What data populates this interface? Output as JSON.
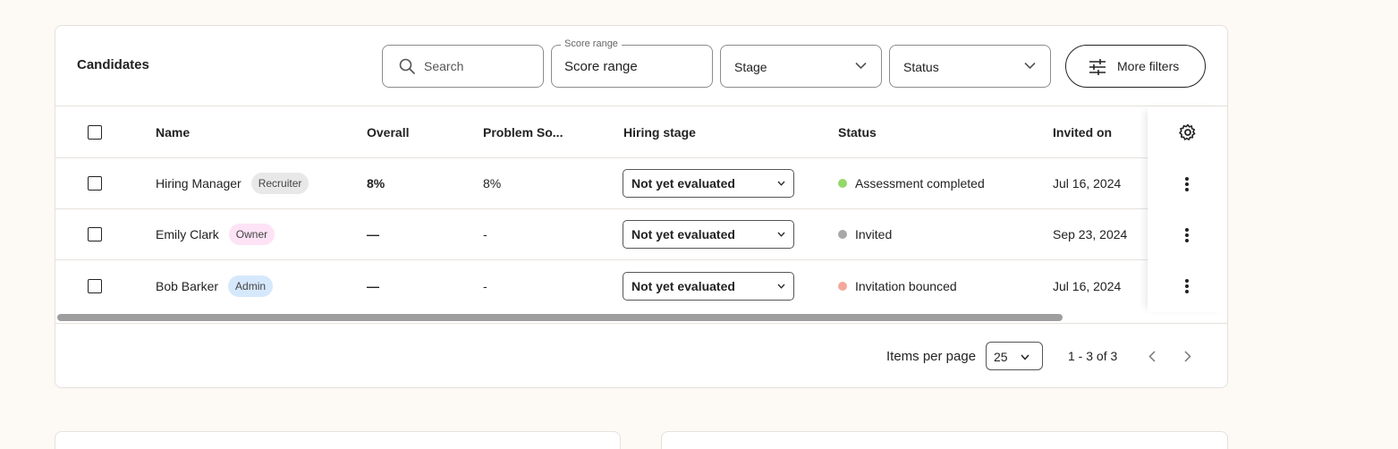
{
  "card": {
    "title": "Candidates",
    "filters": {
      "search_placeholder": "Search",
      "score_range_legend": "Score range",
      "score_range_value": "Score range",
      "stage_label": "Stage",
      "status_label": "Status",
      "more_filters_label": "More filters"
    }
  },
  "table": {
    "headers": {
      "name": "Name",
      "overall": "Overall",
      "problem_solving": "Problem So...",
      "hiring_stage": "Hiring stage",
      "status": "Status",
      "invited_on": "Invited on"
    },
    "rows": [
      {
        "name": "Hiring Manager",
        "role": "Recruiter",
        "role_color": "#e8e8e8",
        "overall": "8%",
        "problem_solving": "8%",
        "hiring_stage": "Not yet evaluated",
        "status": "Assessment completed",
        "status_color": "#94d86a",
        "invited_on": "Jul 16, 2024"
      },
      {
        "name": "Emily Clark",
        "role": "Owner",
        "role_color": "#fde3f5",
        "overall": "—",
        "problem_solving": "-",
        "hiring_stage": "Not yet evaluated",
        "status": "Invited",
        "status_color": "#a8a8a8",
        "invited_on": "Sep 23, 2024"
      },
      {
        "name": "Bob Barker",
        "role": "Admin",
        "role_color": "#d6e8fc",
        "overall": "—",
        "problem_solving": "-",
        "hiring_stage": "Not yet evaluated",
        "status": "Invitation bounced",
        "status_color": "#f4a89a",
        "invited_on": "Jul 16, 2024"
      }
    ]
  },
  "pagination": {
    "items_per_page_label": "Items per page",
    "items_per_page_value": "25",
    "range_text": "1 - 3 of 3"
  },
  "colors": {
    "background": "#fdf9f4",
    "border": "#e5e1dc",
    "text": "#222222"
  }
}
